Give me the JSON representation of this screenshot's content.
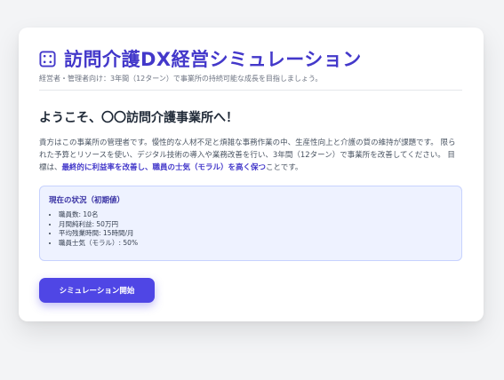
{
  "header": {
    "icon": "dice-icon",
    "title": "訪問介護DX経営シミュレーション",
    "subtitle": "経営者・管理者向け：3年間（12ターン）で事業所の持続可能な成長を目指しましょう。"
  },
  "intro": {
    "welcome": "ようこそ、〇〇訪問介護事業所へ！",
    "paragraph_before": "貴方はこの事業所の管理者です。慢性的な人材不足と煩雑な事務作業の中、生産性向上と介護の質の維持が課題です。 限られた予算とリソースを使い、デジタル技術の導入や業務改善を行い、3年間（12ターン）で事業所を改善してください。 目標は、",
    "goal_emphasis": "最終的に利益率を改善し、職員の士気（モラル）を高く保つ",
    "paragraph_after": "ことです。"
  },
  "status": {
    "heading": "現在の状況（初期値）",
    "items": [
      "職員数: 10名",
      "月間純利益: 50万円",
      "平均残業時間: 15時間/月",
      "職員士気（モラル）: 50%"
    ]
  },
  "actions": {
    "start_label": "シミュレーション開始"
  },
  "colors": {
    "accent": "#4338ca",
    "button": "#4f46e5",
    "status_bg": "#eef2ff"
  }
}
